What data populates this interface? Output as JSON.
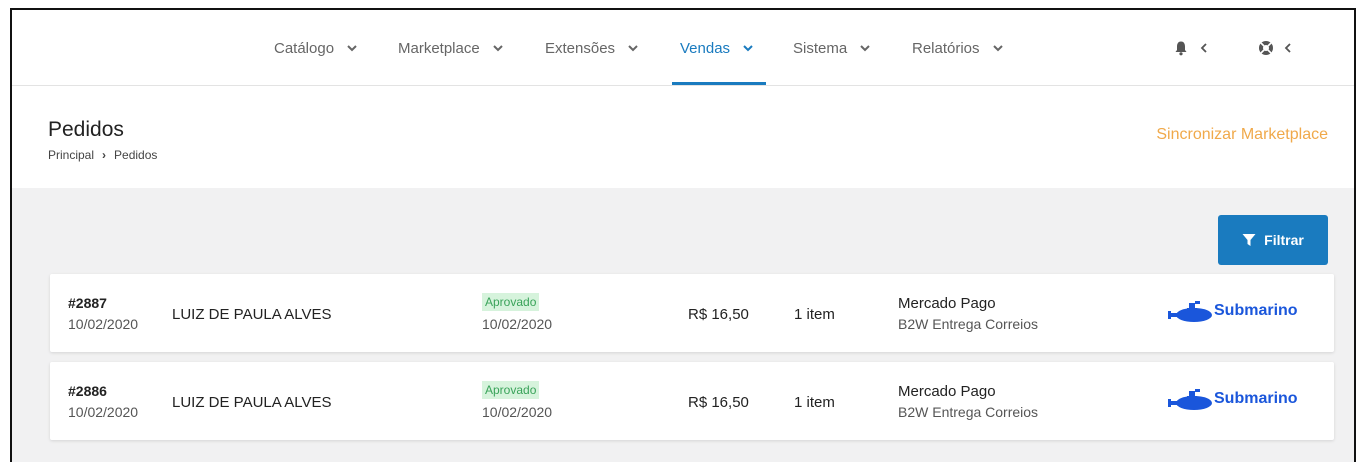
{
  "nav": {
    "items": [
      {
        "label": "Catálogo"
      },
      {
        "label": "Marketplace"
      },
      {
        "label": "Extensões"
      },
      {
        "label": "Vendas"
      },
      {
        "label": "Sistema"
      },
      {
        "label": "Relatórios"
      }
    ],
    "active": "Vendas",
    "icons": [
      "bell-icon",
      "chevron-left-icon",
      "lifebuoy-icon",
      "chevron-left-icon"
    ]
  },
  "header": {
    "title": "Pedidos",
    "breadcrumb": {
      "root": "Principal",
      "sep": "›",
      "current": "Pedidos"
    },
    "sync_label": "Sincronizar Marketplace"
  },
  "toolbar": {
    "filter_label": "Filtrar"
  },
  "orders": [
    {
      "id": "#2887",
      "date": "10/02/2020",
      "customer": "LUIZ DE PAULA ALVES",
      "status": "Aprovado",
      "status_date": "10/02/2020",
      "price": "R$ 16,50",
      "items": "1 item",
      "payment": "Mercado Pago",
      "shipping": "B2W Entrega Correios",
      "marketplace": "Submarino"
    },
    {
      "id": "#2886",
      "date": "10/02/2020",
      "customer": "LUIZ DE PAULA ALVES",
      "status": "Aprovado",
      "status_date": "10/02/2020",
      "price": "R$ 16,50",
      "items": "1 item",
      "payment": "Mercado Pago",
      "shipping": "B2W Entrega Correios",
      "marketplace": "Submarino"
    }
  ],
  "colors": {
    "accent": "#1a7bbf",
    "sync_link": "#f0a94a",
    "status_text": "#3aa35a",
    "status_bg": "#d6f3dc",
    "logo": "#1a56db"
  }
}
